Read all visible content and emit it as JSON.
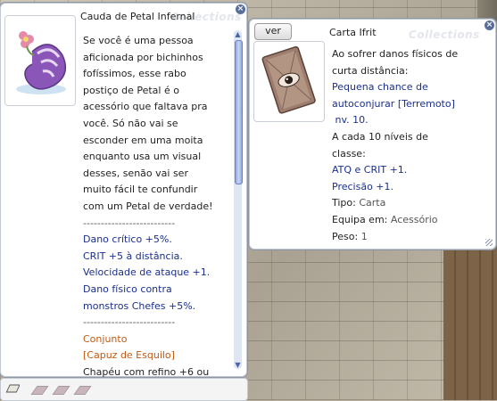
{
  "left_window": {
    "title": "Cauda de Petal Infernal",
    "watermark": "Collections",
    "description_lines": [
      "Se você é uma pessoa",
      "aficionada por bichinhos",
      "fofíssimos, esse rabo",
      "postiço de Petal é o",
      "acessório que faltava pra",
      "você. Só não vai se",
      "esconder em uma moita",
      "enquanto usa um visual",
      "desses, senão vai ser",
      "muito fácil te confundir",
      "com um Petal de verdade!"
    ],
    "separator": "--------------------------",
    "effects": [
      "Dano crítico +5%.",
      "CRIT +5 à distância.",
      "Velocidade de ataque +1.",
      "Dano físico contra",
      "monstros Chefes +5%."
    ],
    "set_label": "Conjunto",
    "set_item": "[Capuz de Esquilo]",
    "set_effect": "Chapéu com refino +6 ou"
  },
  "right_window": {
    "title": "Carta Ifrit",
    "watermark": "Collections",
    "view_button": "ver",
    "effect_lines": [
      "Ao sofrer danos físicos de",
      "curta distância:"
    ],
    "effect_blue_lines": [
      "Pequena chance de",
      "autoconjurar [Terremoto]",
      " nv. 10."
    ],
    "bonus_intro": [
      "A cada 10 níveis de",
      "classe:"
    ],
    "bonus_lines": [
      "ATQ e CRIT +1.",
      "Precisão +1."
    ],
    "type_label": "Tipo:",
    "type_value": "Carta",
    "equip_label": "Equipa em:",
    "equip_value": "Acessório",
    "weight_label": "Peso:",
    "weight_value": "1"
  },
  "icons": {
    "close": "×",
    "scroll_up": "▲",
    "scroll_down": "▼"
  }
}
